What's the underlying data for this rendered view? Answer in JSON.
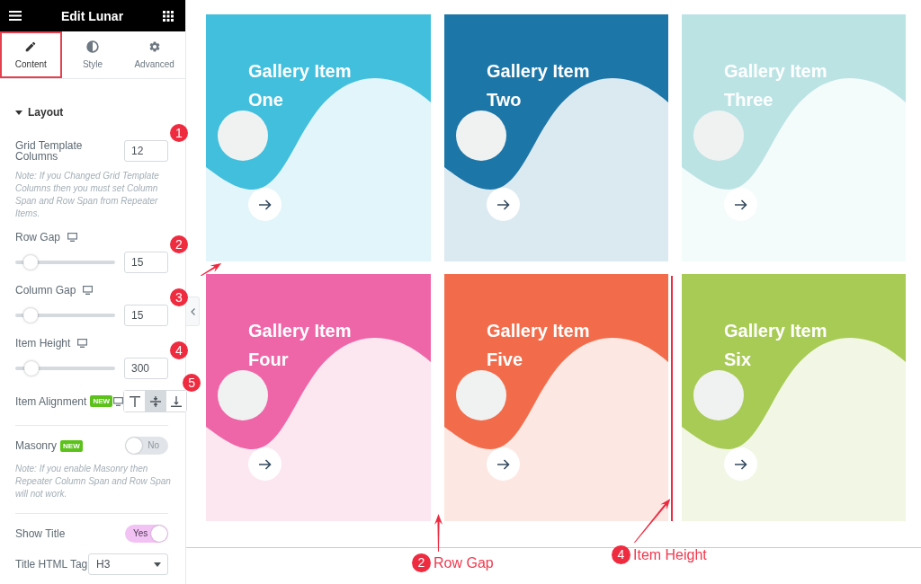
{
  "editor_panel": {
    "title": "Edit Lunar",
    "tabs": [
      {
        "label": "Content",
        "selected": true
      },
      {
        "label": "Style",
        "selected": false
      },
      {
        "label": "Advanced",
        "selected": false
      }
    ],
    "section": {
      "title": "Layout",
      "expanded": true,
      "groups": [
        {
          "controls": [
            {
              "kind": "number",
              "label": "Grid Template Columns",
              "value": "12",
              "marker": "1"
            },
            {
              "kind": "note",
              "text": "Note: If you Changed Grid Template Columns then you must set Column Span and Row Span from Repeater Items."
            },
            {
              "kind": "slider",
              "label": "Row Gap",
              "level": 0.15,
              "value": "15",
              "marker": "2"
            },
            {
              "kind": "slider",
              "label": "Column Gap",
              "level": 0.15,
              "value": "15",
              "marker": "3"
            },
            {
              "kind": "slider",
              "label": "Item Height",
              "level": 0.16,
              "value": "300",
              "marker": "4"
            },
            {
              "kind": "choice",
              "label": "Item Alignment",
              "badge": "NEW",
              "marker": "5",
              "options": [
                {
                  "selected": false
                },
                {
                  "selected": true
                },
                {
                  "selected": false
                }
              ]
            }
          ]
        },
        {
          "controls": [
            {
              "kind": "switch",
              "label": "Masonry",
              "badge": "NEW",
              "on": false,
              "switch_text": "No"
            },
            {
              "kind": "note",
              "text": "Note: If you enable Masonry then Repeater Column Span and Row Span will not work."
            }
          ]
        },
        {
          "controls": [
            {
              "kind": "switch",
              "label": "Show Title",
              "on": true,
              "switch_text": "Yes"
            },
            {
              "kind": "select",
              "label": "Title HTML Tag",
              "value": "H3"
            }
          ]
        }
      ]
    }
  },
  "gallery": {
    "items": [
      {
        "title": "Gallery Item One",
        "color": "#42bfdd"
      },
      {
        "title": "Gallery Item Two",
        "color": "#1d76a8"
      },
      {
        "title": "Gallery Item Three",
        "color": "#bce3e4"
      },
      {
        "title": "Gallery Item Four",
        "color": "#ef66a8"
      },
      {
        "title": "Gallery Item Five",
        "color": "#f26c4b"
      },
      {
        "title": "Gallery Item Six",
        "color": "#a8cb56"
      }
    ]
  },
  "annotations": [
    {
      "number": "2",
      "label": "Row Gap"
    },
    {
      "number": "4",
      "label": "Item Height"
    }
  ]
}
